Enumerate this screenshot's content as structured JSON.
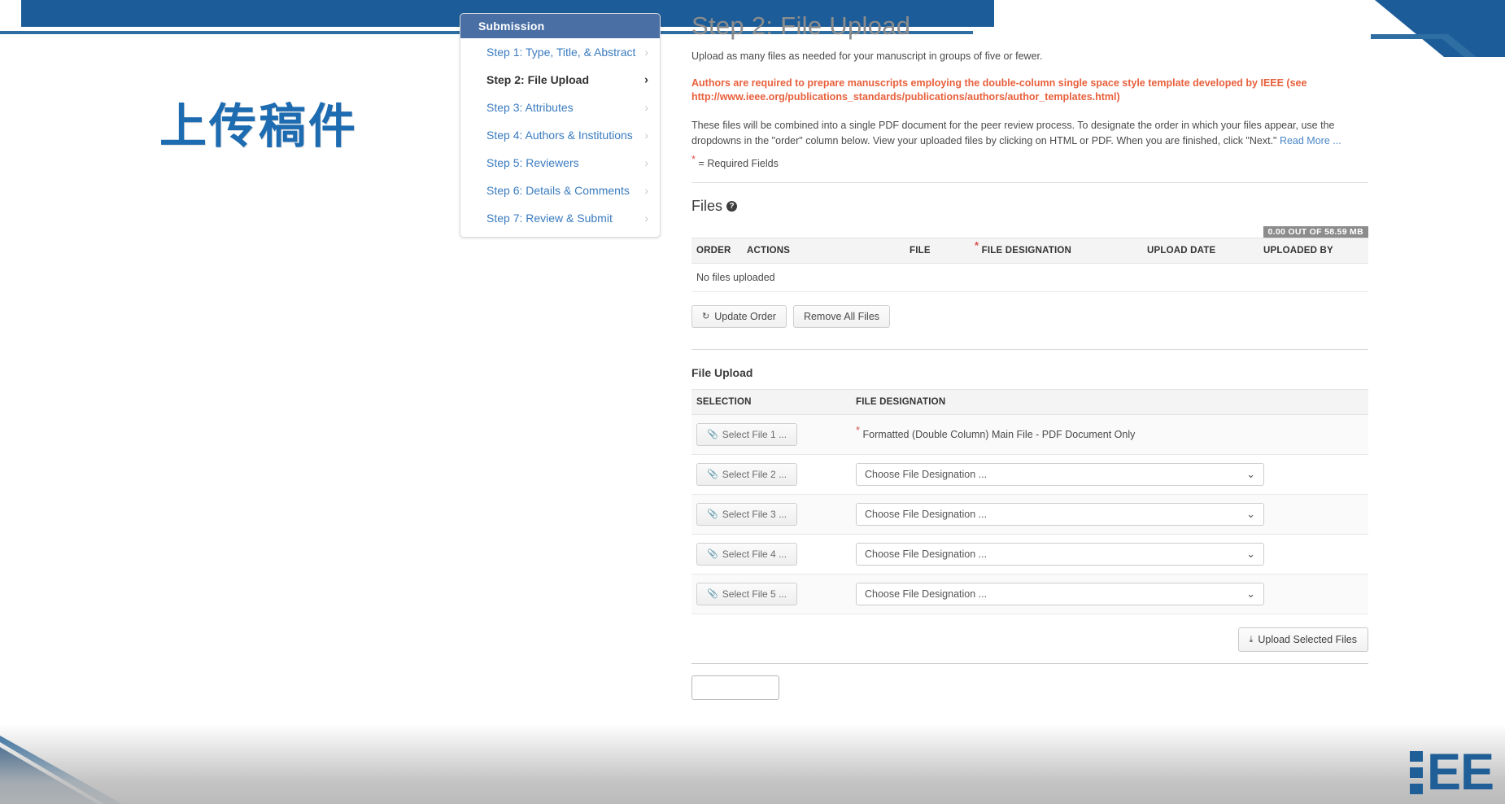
{
  "slide": {
    "title": "上传稿件",
    "logo": {
      "letters": "EE",
      "bars_icon": "ieee-bars-icon"
    }
  },
  "sidebar": {
    "header": "Submission",
    "items": [
      {
        "label": "Step 1: Type, Title, & Abstract",
        "active": false
      },
      {
        "label": "Step 2: File Upload",
        "active": true
      },
      {
        "label": "Step 3: Attributes",
        "active": false
      },
      {
        "label": "Step 4: Authors & Institutions",
        "active": false
      },
      {
        "label": "Step 5: Reviewers",
        "active": false
      },
      {
        "label": "Step 6: Details & Comments",
        "active": false
      },
      {
        "label": "Step 7: Review & Submit",
        "active": false
      }
    ],
    "chevron": "›"
  },
  "main": {
    "page_title": "Step 2: File Upload",
    "subtitle": "Upload as many files as needed for your manuscript in groups of five or fewer.",
    "warning": "Authors are required to prepare manuscripts employing the double-column single space style template developed by IEEE (see http://www.ieee.org/publications_standards/publications/authors/author_templates.html)",
    "body_paragraph": "These files will be combined into a single PDF document for the peer review process. To designate the order in which your files appear, use the dropdowns in the \"order\" column below. View your uploaded files by clicking on HTML or PDF. When you are finished, click \"Next.\" ",
    "read_more_link": "Read More ...",
    "required_star": "*",
    "required_legend": "= Required Fields"
  },
  "files_section": {
    "heading": "Files",
    "help_icon": "help-icon",
    "quota_badge": "0.00 OUT OF 58.59 MB",
    "columns": [
      "ORDER",
      "ACTIONS",
      "FILE",
      "FILE DESIGNATION",
      "UPLOAD DATE",
      "UPLOADED BY"
    ],
    "designation_required": true,
    "empty_message": "No files uploaded",
    "buttons": [
      {
        "label": "Update Order",
        "icon": "refresh-icon",
        "glyph": "↻"
      },
      {
        "label": "Remove All Files",
        "icon": null,
        "glyph": ""
      }
    ]
  },
  "file_upload_section": {
    "heading": "File Upload",
    "columns": [
      "SELECTION",
      "FILE DESIGNATION"
    ],
    "rows": [
      {
        "select_label": "Select File 1 ...",
        "icon": "paperclip-icon",
        "designation_type": "static",
        "designation_required": true,
        "designation": "Formatted (Double Column) Main File - PDF Document Only"
      },
      {
        "select_label": "Select File 2 ...",
        "icon": "paperclip-icon",
        "designation_type": "dropdown",
        "designation_required": false,
        "designation": "Choose File Designation ..."
      },
      {
        "select_label": "Select File 3 ...",
        "icon": "paperclip-icon",
        "designation_type": "dropdown",
        "designation_required": false,
        "designation": "Choose File Designation ..."
      },
      {
        "select_label": "Select File 4 ...",
        "icon": "paperclip-icon",
        "designation_type": "dropdown",
        "designation_required": false,
        "designation": "Choose File Designation ..."
      },
      {
        "select_label": "Select File 5 ...",
        "icon": "paperclip-icon",
        "designation_type": "dropdown",
        "designation_required": false,
        "designation": "Choose File Designation ..."
      }
    ],
    "upload_button": {
      "label": "Upload Selected Files",
      "icon": "upload-icon",
      "glyph": "⤓"
    }
  },
  "colors": {
    "accent_blue": "#1c5d99",
    "title_blue": "#1d6bb0",
    "sidebar_header": "#4a6fa5",
    "link_blue": "#3a7bbf",
    "warning_red": "#e8603c",
    "required_red": "#d9534f",
    "badge_gray": "#8c8c8c"
  }
}
